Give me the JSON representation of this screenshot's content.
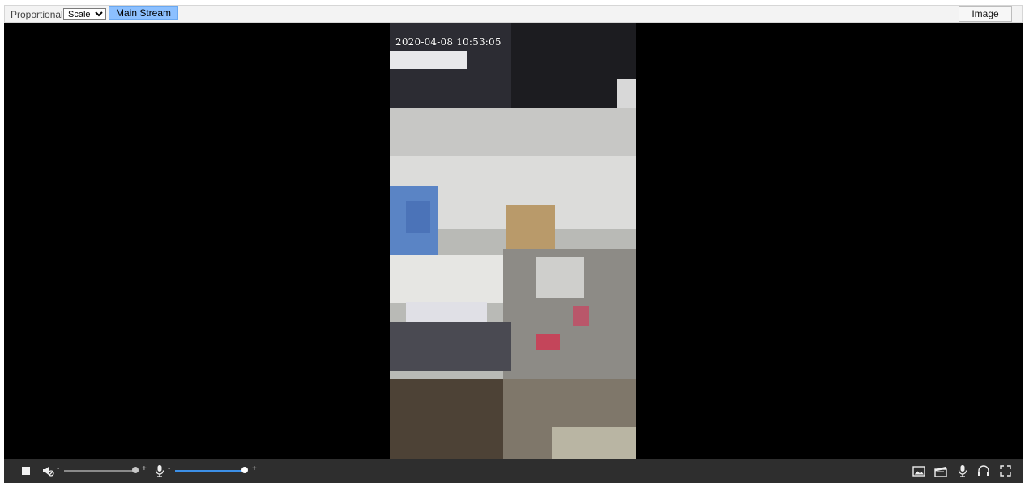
{
  "toolbar": {
    "scale_label": "Proportional",
    "scale_select": {
      "selected": "Scale",
      "options": [
        "Scale"
      ]
    },
    "stream_button": "Main Stream",
    "image_button": "Image"
  },
  "video": {
    "timestamp": "2020-04-08 10:53:05"
  },
  "controls": {
    "stop_icon": "stop-icon",
    "speaker_icon": "speaker-muted-icon",
    "volume_minus": "-",
    "volume_plus": "+",
    "volume_level": 0.95,
    "mic_icon": "microphone-icon",
    "mic_minus": "-",
    "mic_plus": "+",
    "mic_level": 0.97,
    "right_icons": [
      "snapshot-icon",
      "record-icon",
      "talk-icon",
      "headset-icon",
      "fullscreen-icon"
    ],
    "accent_color": "#3c8fe6"
  }
}
